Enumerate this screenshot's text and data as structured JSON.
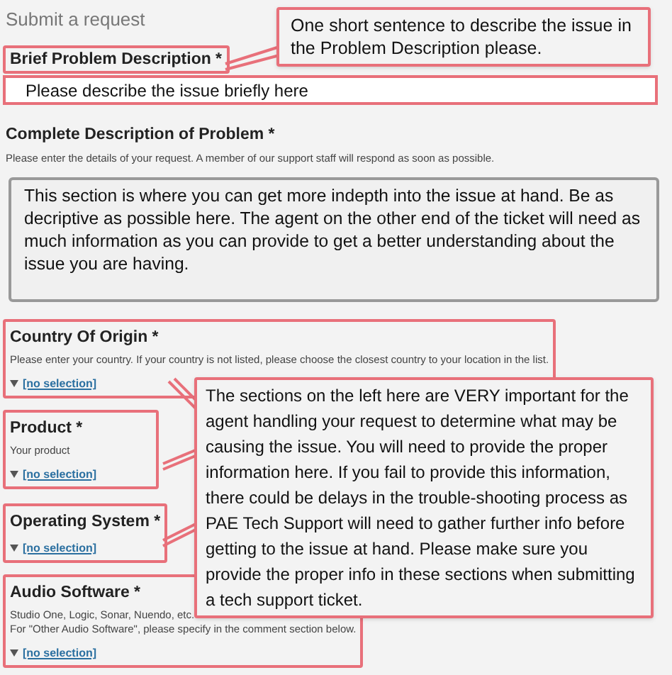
{
  "page_title": "Submit a request",
  "brief": {
    "label": "Brief Problem Description *",
    "value": "Please describe the issue briefly here"
  },
  "complete": {
    "label": "Complete Description of Problem *",
    "help": "Please enter the details of your request. A member of our support staff will respond as soon as possible.",
    "value": "This section is where you can get more indepth into the issue at hand. Be as decriptive as possible here. The agent on the other end of the ticket will need as much information as you can provide to get a better understanding about the issue you are having."
  },
  "sections": [
    {
      "label": "Country Of Origin *",
      "help": [
        "Please enter your country. If your country is not listed, please choose the closest country to your location in the list."
      ],
      "value": "[no selection]"
    },
    {
      "label": "Product *",
      "help": [
        "Your product"
      ],
      "value": "[no selection]"
    },
    {
      "label": "Operating System *",
      "value": "[no selection]"
    },
    {
      "label": "Audio Software *",
      "help": [
        "Studio One, Logic, Sonar, Nuendo, etc.",
        "For \"Other Audio Software\", please specify in the comment section below."
      ],
      "value": "[no selection]"
    }
  ],
  "callouts": [
    {
      "text": "One short sentence to describe the issue in the Problem Description please."
    },
    {
      "text": "The sections on the left here are VERY important for the agent handling your request to determine what may be causing the issue. You will need to provide the proper information here. If you fail to provide this information, there could be delays in the trouble-shooting process as PAE Tech Support will need to gather further info before getting to the issue at hand. Please make sure you provide the proper info in these sections when submitting a tech support ticket."
    }
  ]
}
